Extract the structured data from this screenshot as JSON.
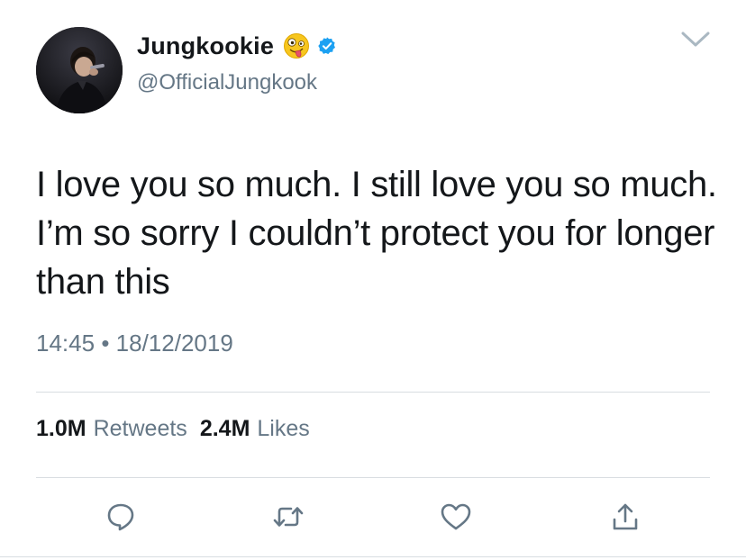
{
  "tweet": {
    "author": {
      "display_name": "Jungkookie",
      "emoji_icon": "zany-face-emoji",
      "verified": true,
      "handle": "@OfficialJungkook"
    },
    "text": "I love you so much. I still love you so much. I’m so sorry I couldn’t protect you for longer than this",
    "time": "14:45",
    "separator": "•",
    "date": "18/12/2019",
    "stats": {
      "retweets_count": "1.0M",
      "retweets_label": "Retweets",
      "likes_count": "2.4M",
      "likes_label": "Likes"
    },
    "actions": [
      "reply-icon",
      "retweet-icon",
      "like-icon",
      "share-icon"
    ]
  },
  "colors": {
    "text_primary": "#14171a",
    "text_secondary": "#657786",
    "verified_blue": "#1da1f2",
    "icon_gray": "#657786",
    "divider": "#d8dde1"
  }
}
